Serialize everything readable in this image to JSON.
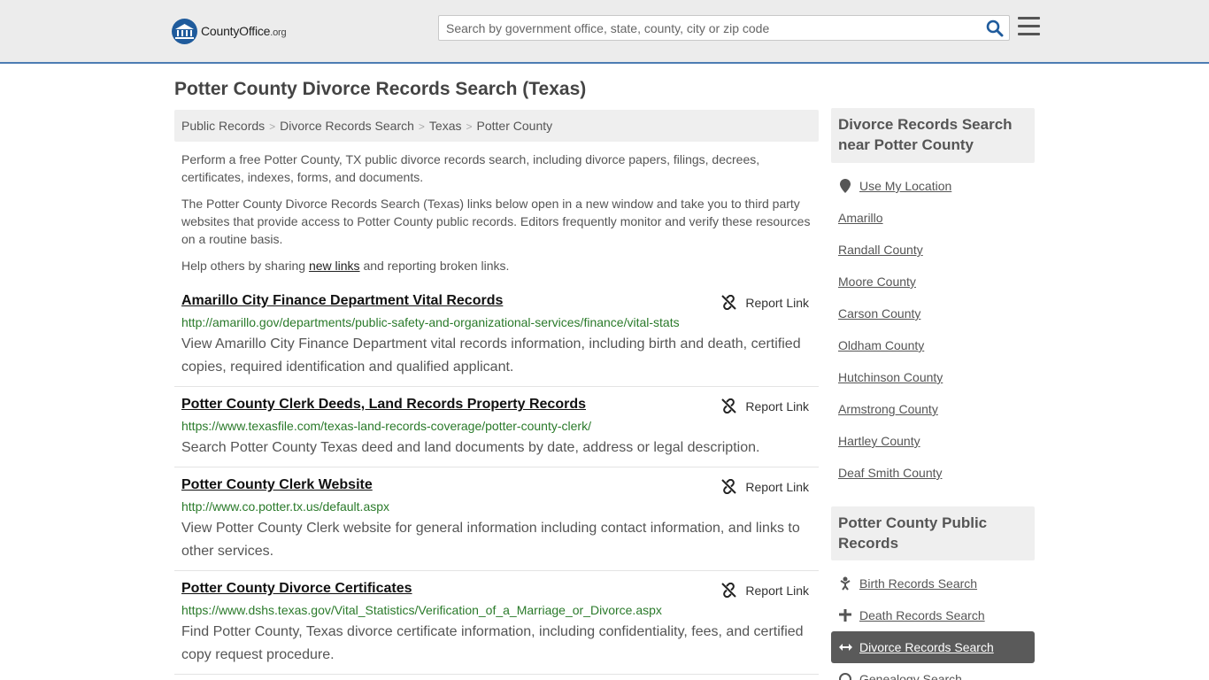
{
  "header": {
    "logo_text_main": "CountyOffice",
    "logo_text_tld": ".org",
    "search_placeholder": "Search by government office, state, county, city or zip code"
  },
  "page_title": "Potter County Divorce Records Search (Texas)",
  "breadcrumb": [
    "Public Records",
    "Divorce Records Search",
    "Texas",
    "Potter County"
  ],
  "intro": {
    "p1": "Perform a free Potter County, TX public divorce records search, including divorce papers, filings, decrees, certificates, indexes, forms, and documents.",
    "p2": "The Potter County Divorce Records Search (Texas) links below open in a new window and take you to third party websites that provide access to Potter County public records. Editors frequently monitor and verify these resources on a routine basis.",
    "p3_before": "Help others by sharing ",
    "p3_link": "new links",
    "p3_after": " and reporting broken links."
  },
  "report_label": "Report Link",
  "records": [
    {
      "title": "Amarillo City Finance Department Vital Records",
      "url": "http://amarillo.gov/departments/public-safety-and-organizational-services/finance/vital-stats",
      "desc": "View Amarillo City Finance Department vital records information, including birth and death, certified copies, required identification and qualified applicant."
    },
    {
      "title": "Potter County Clerk Deeds, Land Records Property Records",
      "url": "https://www.texasfile.com/texas-land-records-coverage/potter-county-clerk/",
      "desc": "Search Potter County Texas deed and land documents by date, address or legal description."
    },
    {
      "title": "Potter County Clerk Website",
      "url": "http://www.co.potter.tx.us/default.aspx",
      "desc": "View Potter County Clerk website for general information including contact information, and links to other services."
    },
    {
      "title": "Potter County Divorce Certificates",
      "url": "https://www.dshs.texas.gov/Vital_Statistics/Verification_of_a_Marriage_or_Divorce.aspx",
      "desc": "Find Potter County, Texas divorce certificate information, including confidentiality, fees, and certified copy request procedure."
    }
  ],
  "sidebar": {
    "nearby_heading": "Divorce Records Search near Potter County",
    "use_location": "Use My Location",
    "nearby": [
      "Amarillo",
      "Randall County",
      "Moore County",
      "Carson County",
      "Oldham County",
      "Hutchinson County",
      "Armstrong County",
      "Hartley County",
      "Deaf Smith County"
    ],
    "public_heading": "Potter County Public Records",
    "public_links": [
      "Birth Records Search",
      "Death Records Search",
      "Divorce Records Search",
      "Genealogy Search"
    ]
  },
  "colors": {
    "header_bg": "#ececec",
    "header_border": "#4d7db3",
    "url_green": "#2a7a2a",
    "active_bg": "#5a5a5a",
    "logo_blue": "#1f5b9c"
  }
}
